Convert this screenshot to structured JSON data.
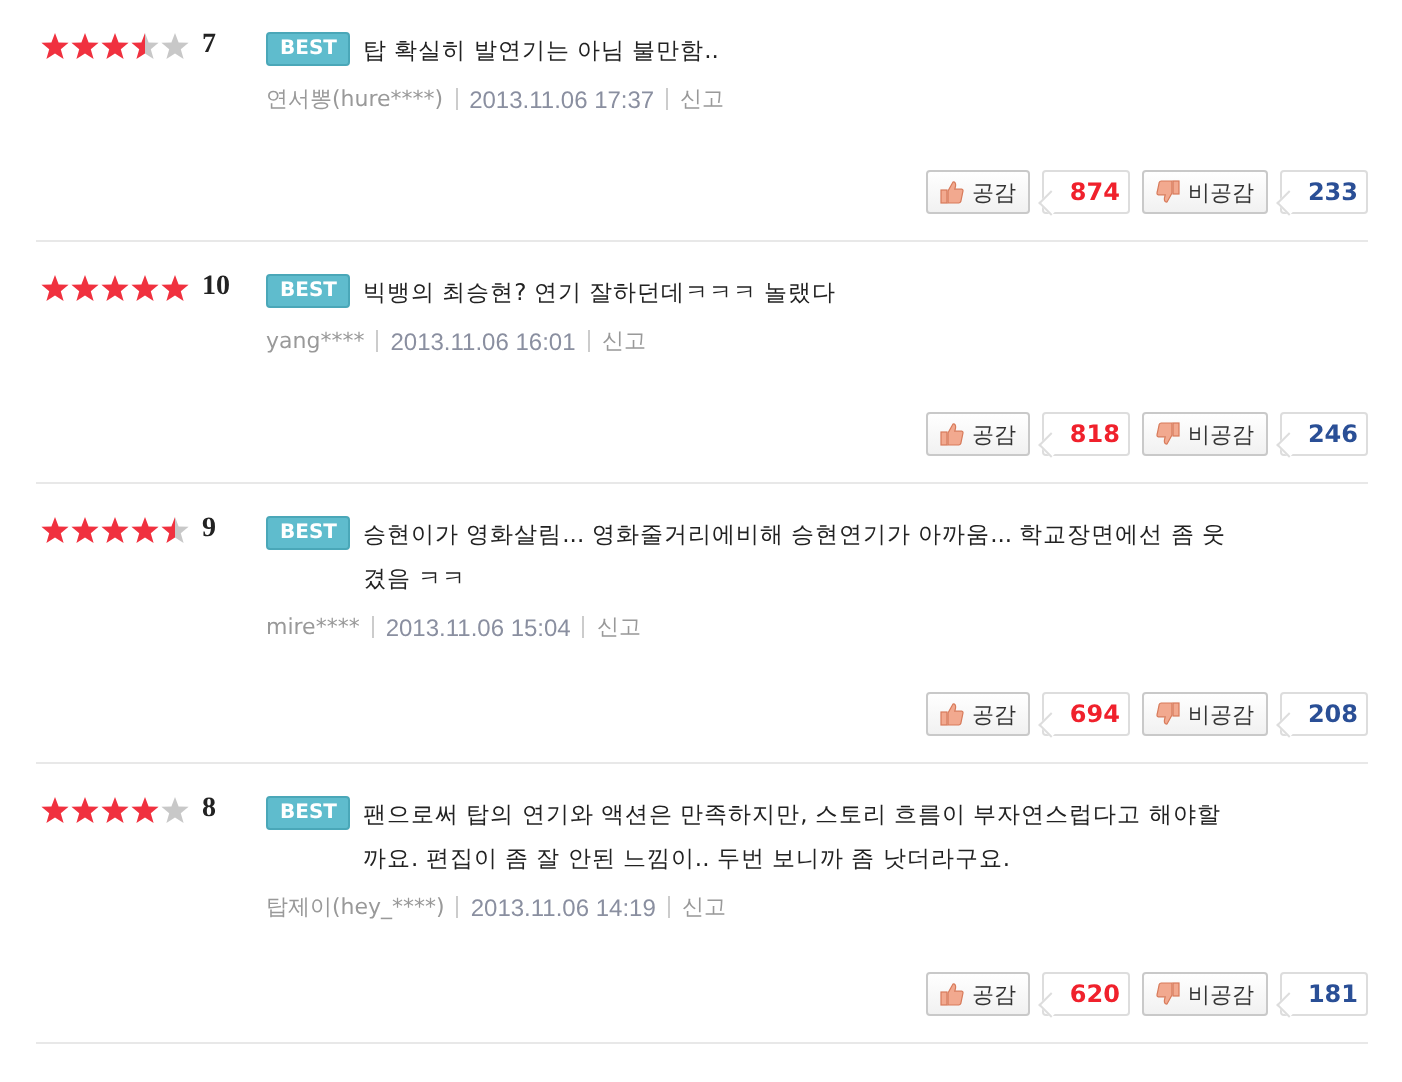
{
  "comments": [
    {
      "stars": 3.5,
      "score": "7",
      "badge": "BEST",
      "text": "탑 확실히 발연기는 아님 불만함..",
      "author": "연서뽕(hure****)",
      "date": "2013.11.06 17:37",
      "report": "신고",
      "like_label": "공감",
      "likes": "874",
      "dislike_label": "비공감",
      "dislikes": "233"
    },
    {
      "stars": 5,
      "score": "10",
      "badge": "BEST",
      "text": "빅뱅의 최승현? 연기 잘하던데ㅋㅋㅋ 놀랬다",
      "author": "yang****",
      "date": "2013.11.06 16:01",
      "report": "신고",
      "like_label": "공감",
      "likes": "818",
      "dislike_label": "비공감",
      "dislikes": "246"
    },
    {
      "stars": 4.5,
      "score": "9",
      "badge": "BEST",
      "text": "승현이가 영화살림... 영화줄거리에비해 승현연기가 아까움... 학교장면에선 좀 웃겼음 ㅋㅋ",
      "author": "mire****",
      "date": "2013.11.06 15:04",
      "report": "신고",
      "like_label": "공감",
      "likes": "694",
      "dislike_label": "비공감",
      "dislikes": "208"
    },
    {
      "stars": 4,
      "score": "8",
      "badge": "BEST",
      "text": "팬으로써 탑의 연기와 액션은 만족하지만, 스토리 흐름이 부자연스럽다고 해야할까요. 편집이 좀 잘 안된 느낌이.. 두번 보니까 좀 낫더라구요.",
      "author": "탑제이(hey_****)",
      "date": "2013.11.06 14:19",
      "report": "신고",
      "like_label": "공감",
      "likes": "620",
      "dislike_label": "비공감",
      "dislikes": "181"
    }
  ]
}
